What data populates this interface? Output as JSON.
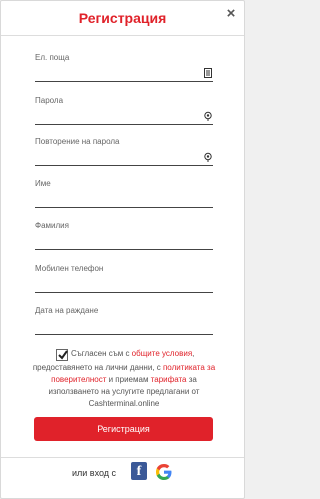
{
  "header": {
    "title": "Регистрация",
    "close_icon": "×"
  },
  "fields": {
    "email": "Ел. поща",
    "password": "Парола",
    "password_repeat": "Повторение на парола",
    "first_name": "Име",
    "last_name": "Фамилия",
    "phone": "Мобилен телефон",
    "birth_date": "Дата на раждане"
  },
  "consent": {
    "checked": true,
    "prefix": "Съгласен съм с ",
    "terms_link": "общите условия",
    "after_terms": ",",
    "line2_text": "предоставянето на лични данни, с ",
    "privacy_link": "политиката за поверителност",
    "and_text": " и приемам ",
    "tariff_link": "тарифата",
    "suffix": " за използването на услугите предлагани от Cashterminal.online"
  },
  "register_button": "Регистрация",
  "footer": {
    "or_login": "или вход с",
    "facebook_glyph": "f"
  },
  "colors": {
    "accent": "#e0222a",
    "facebook": "#3b5998"
  }
}
